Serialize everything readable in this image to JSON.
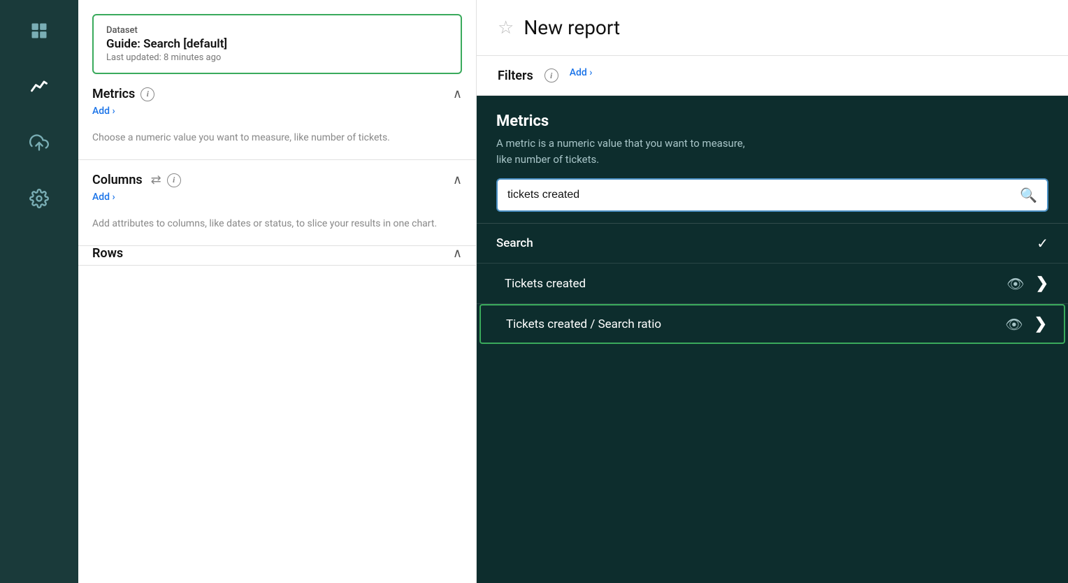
{
  "sidebar": {
    "icons": [
      {
        "name": "grid-icon",
        "symbol": "⊞",
        "active": false
      },
      {
        "name": "chart-icon",
        "symbol": "📈",
        "active": true
      },
      {
        "name": "upload-icon",
        "symbol": "⬆",
        "active": false
      },
      {
        "name": "gear-icon",
        "symbol": "⚙",
        "active": false
      }
    ]
  },
  "dataset": {
    "label": "Dataset",
    "name": "Guide: Search [default]",
    "updated": "Last updated: 8 minutes ago"
  },
  "left": {
    "metrics_title": "Metrics",
    "metrics_add": "Add ›",
    "metrics_desc": "Choose a numeric value you want to measure, like number of tickets.",
    "columns_title": "Columns",
    "columns_add": "Add ›",
    "columns_desc": "Add attributes to columns, like dates or status, to slice your results in one chart.",
    "rows_title": "Rows"
  },
  "report": {
    "title": "New report",
    "star_label": "☆"
  },
  "filters": {
    "label": "Filters",
    "add_label": "Add ›"
  },
  "dropdown": {
    "metrics_title": "Metrics",
    "metrics_desc": "A metric is a numeric value that you want to measure,\nlike number of tickets.",
    "search_placeholder": "tickets created",
    "section_label": "Search",
    "results": [
      {
        "label": "Tickets created",
        "highlighted": false
      },
      {
        "label": "Tickets created / Search ratio",
        "highlighted": true
      }
    ]
  }
}
